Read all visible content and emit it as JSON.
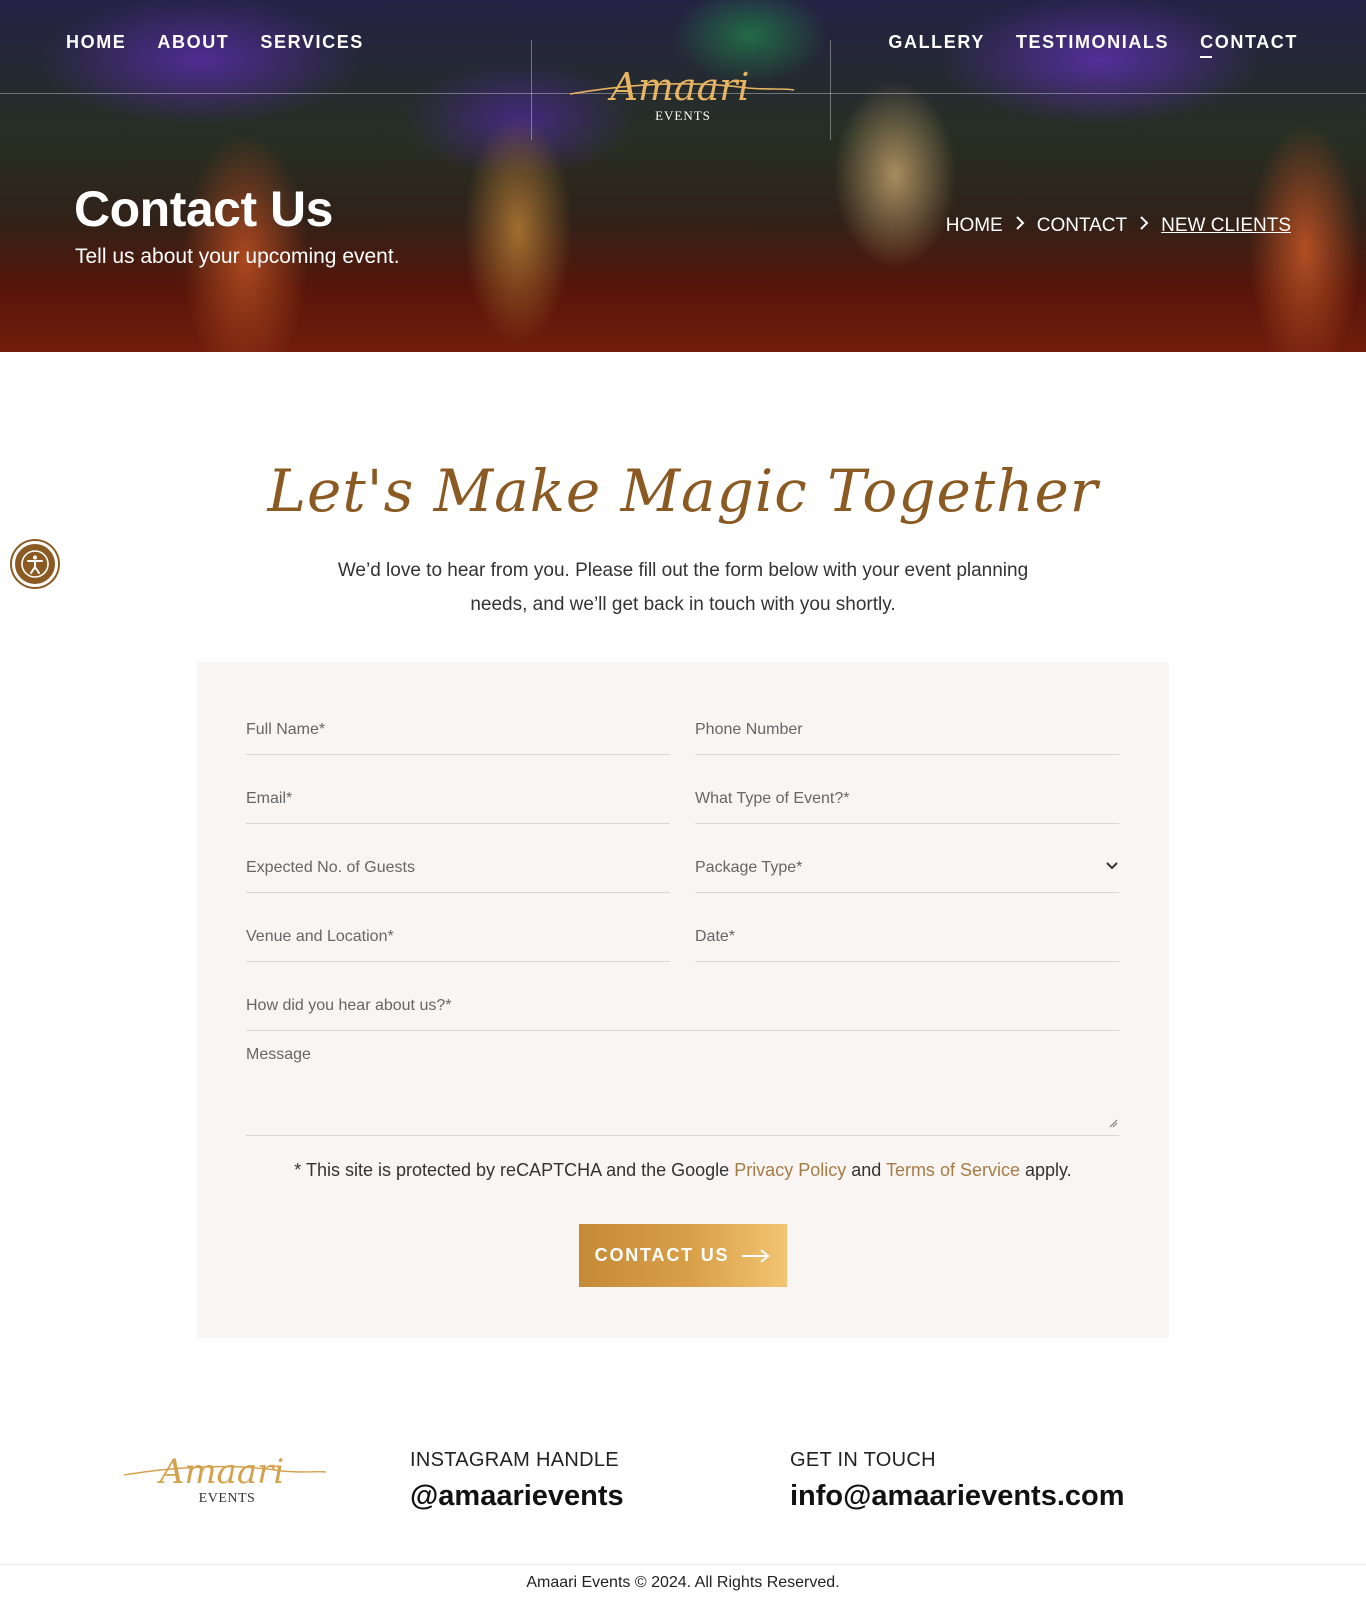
{
  "nav": {
    "left": [
      "HOME",
      "ABOUT",
      "SERVICES"
    ],
    "right": [
      "GALLERY",
      "TESTIMONIALS",
      "CONTACT"
    ]
  },
  "logo": {
    "script": "Amaari",
    "subtitle": "EVENTS"
  },
  "hero": {
    "title": "Contact Us",
    "subtitle": "Tell us about your upcoming event.",
    "breadcrumb": [
      "HOME",
      "CONTACT",
      "NEW CLIENTS"
    ]
  },
  "intro": {
    "heading": "Let's Make Magic Together",
    "text": "We’d love to hear from you. Please fill out the form below with your event planning needs, and we’ll get back in touch with you shortly."
  },
  "form": {
    "full_name": "Full Name*",
    "phone": "Phone Number",
    "email": "Email*",
    "event_type": "What Type of Event?*",
    "guests": "Expected No. of Guests",
    "package": "Package Type*",
    "venue": "Venue and Location*",
    "date": "Date*",
    "hear_about": "How did you hear about us?*",
    "message": "Message",
    "recaptcha_prefix": "* This site is protected by reCAPTCHA and the Google ",
    "privacy": "Privacy Policy",
    "and": " and ",
    "terms": "Terms of Service",
    "apply": " apply.",
    "submit": "CONTACT US"
  },
  "footer": {
    "logo_script": "Amaari",
    "logo_subtitle": "EVENTS",
    "instagram_label": "INSTAGRAM HANDLE",
    "instagram_value": "@amaarievents",
    "contact_label": "GET IN TOUCH",
    "contact_value": "info@amaarievents.com",
    "copyright": "Amaari Events © 2024. All Rights Reserved."
  },
  "colors": {
    "gold": "#a67c46",
    "heading_brown": "#8a5a22",
    "form_bg": "#f8f5f3"
  },
  "icons": [
    "accessibility-icon",
    "chevron-right-icon",
    "chevron-down-icon",
    "arrow-right-icon",
    "resize-handle-icon"
  ]
}
